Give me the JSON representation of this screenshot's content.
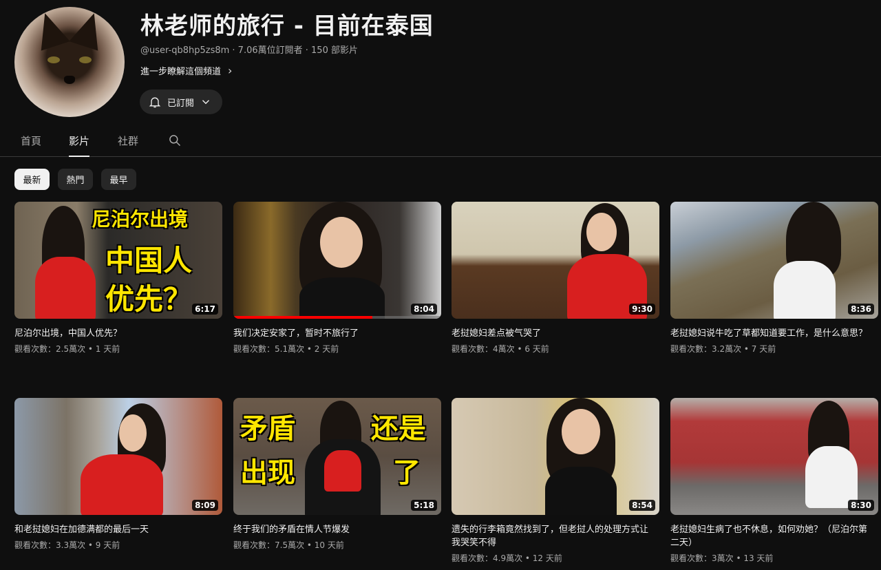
{
  "channel": {
    "title": "林老师的旅行 - 目前在泰国",
    "meta": "@user-qb8hp5zs8m · 7.06萬位訂閱者 · 150 部影片",
    "about": "進一步瞭解這個頻道",
    "subscribe_label": "已訂閱"
  },
  "tabs": [
    {
      "label": "首頁"
    },
    {
      "label": "影片"
    },
    {
      "label": "社群"
    }
  ],
  "filters": [
    {
      "label": "最新"
    },
    {
      "label": "熱門"
    },
    {
      "label": "最早"
    }
  ],
  "videos": [
    {
      "title": "尼泊尔出境，中国人优先？",
      "stats": "觀看次數：2.5萬次 • 1 天前",
      "duration": "6:17",
      "overlay": [
        "尼泊尔出境",
        "中国人",
        "优先？"
      ]
    },
    {
      "title": "我们决定安家了，暂时不旅行了",
      "stats": "觀看次數：5.1萬次 • 2 天前",
      "duration": "8:04",
      "watched": 0.67
    },
    {
      "title": "老挝媳妇差点被气哭了",
      "stats": "觀看次數：4萬次 • 6 天前",
      "duration": "9:30"
    },
    {
      "title": "老挝媳妇说牛吃了草都知道要工作，是什么意思？",
      "stats": "觀看次數：3.2萬次 • 7 天前",
      "duration": "8:36"
    },
    {
      "title": "和老挝媳妇在加德满都的最后一天",
      "stats": "觀看次數：3.3萬次 • 9 天前",
      "duration": "8:09"
    },
    {
      "title": "终于我们的矛盾在情人节爆发",
      "stats": "觀看次數：7.5萬次 • 10 天前",
      "duration": "5:18",
      "overlay": [
        "矛盾",
        "还是",
        "出现",
        "了"
      ]
    },
    {
      "title": "遗失的行李箱竟然找到了，但老挝人的处理方式让我哭笑不得",
      "stats": "觀看次數：4.9萬次 • 12 天前",
      "duration": "8:54"
    },
    {
      "title": "老挝媳妇生病了也不休息，如何劝她？（尼泊尔第二天）",
      "stats": "觀看次數：3萬次 • 13 天前",
      "duration": "8:30"
    }
  ]
}
